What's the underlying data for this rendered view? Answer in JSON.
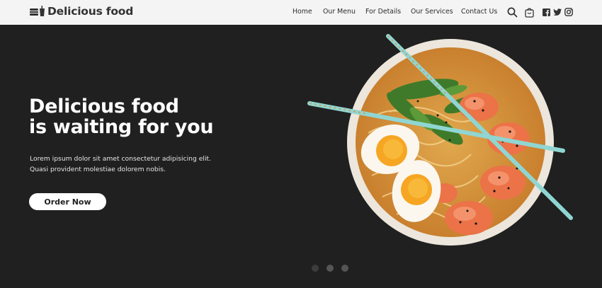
{
  "brand": {
    "name": "Delicious food",
    "logo_icon": "burger-drink-icon"
  },
  "nav": {
    "items": [
      {
        "label": "Home"
      },
      {
        "label": "Our Menu"
      },
      {
        "label": "For Details"
      },
      {
        "label": "Our Services"
      },
      {
        "label": "Contact Us"
      }
    ],
    "icons": [
      "search-icon",
      "cart-icon",
      "facebook-icon",
      "twitter-icon",
      "instagram-icon"
    ]
  },
  "hero": {
    "title_line1": "Delicious food",
    "title_line2": "is waiting for you",
    "description": "Lorem ipsum dolor sit amet consectetur adipisicing elit. Quasi provident molestiae dolorem nobis.",
    "cta_label": "Order Now",
    "image_icon": "ramen-bowl-image",
    "slides": 3,
    "active_slide": 1
  },
  "colors": {
    "navbar_bg": "#f4f4f4",
    "hero_bg": "#202020",
    "text_light": "#ffffff",
    "button_bg": "#ffffff",
    "chopstick": "#8fd6d3"
  }
}
